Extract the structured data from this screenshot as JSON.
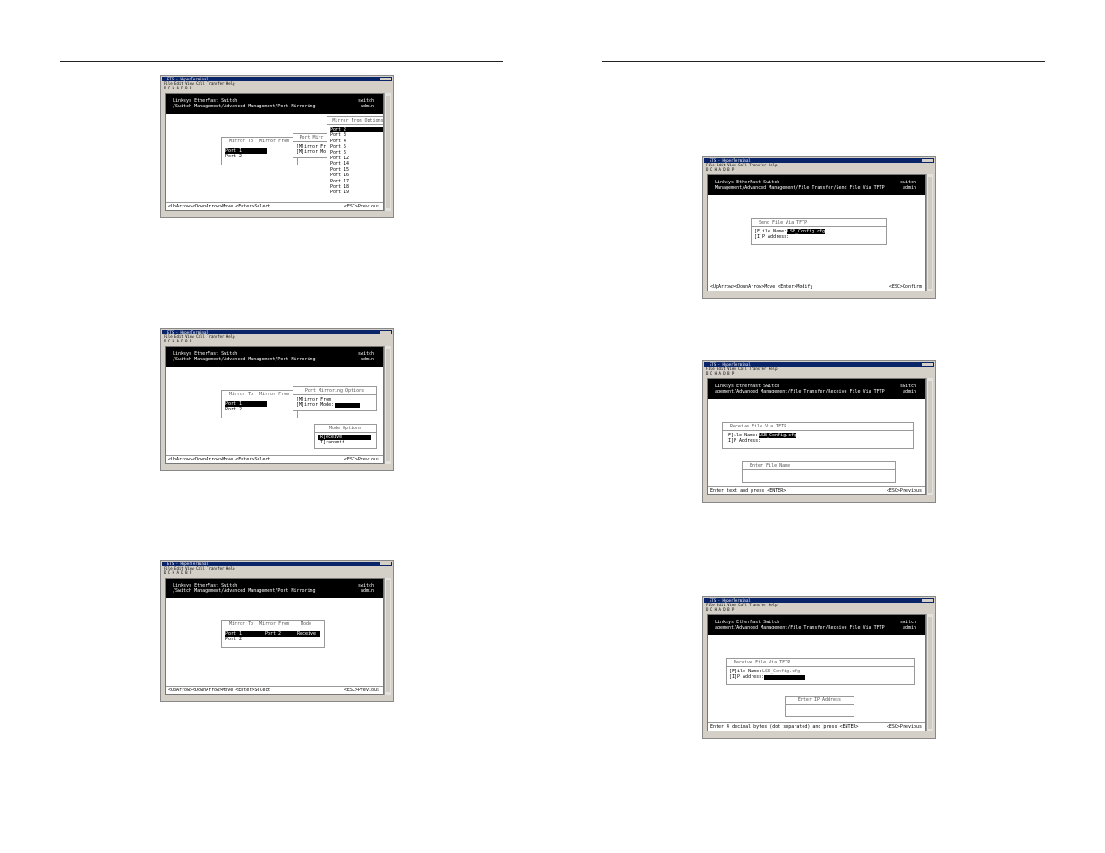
{
  "app": {
    "title": "ETS - HyperTerminal",
    "menu": "File Edit View Call Transfer Help",
    "toolbar": "D  C  H  A  D  B  P"
  },
  "common": {
    "brand": "Linksys EtherFast Switch",
    "hostname": "switch",
    "user": "admin",
    "status_nav": "<UpArrow><DownArrow>Move <Enter>Select",
    "status_back": "<ESC>Previous"
  },
  "shot1": {
    "path": "/Switch Management/Advanced Management/Port Mirroring",
    "col_mirror_to": "Mirror To",
    "col_mirror_from": "Mirror From",
    "rows": [
      "Port 1",
      "Port 2"
    ],
    "options_title": "Port Mirr",
    "option_from": "[M]irror Fr",
    "option_mode": "[M]irror Mo",
    "list_title": "Mirror From Options",
    "ports": [
      "Port 2",
      "Port 3",
      "Port 4",
      "Port 5",
      "Port 6",
      "Port 12",
      "Port 14",
      "Port 15",
      "Port 16",
      "Port 17",
      "Port 18",
      "Port 19"
    ]
  },
  "shot2": {
    "path": "/Switch Management/Advanced Management/Port Mirroring",
    "col_mirror_to": "Mirror To",
    "col_mirror_from": "Mirror From",
    "rows": [
      "Port 1",
      "Port 2"
    ],
    "options_title": "Port Mirroring Options",
    "option_from": "[M]irror From",
    "option_mode": "[M]irror Mode:",
    "mode_title": "Mode Options",
    "modes": [
      "[R]eceive",
      "[T]ransmit"
    ]
  },
  "shot3": {
    "path": "/Switch Management/Advanced Management/Port Mirroring",
    "col_mirror_to": "Mirror To",
    "col_mirror_from": "Mirror From",
    "col_mode": "Mode",
    "row1": {
      "to": "Port 1",
      "from": "Port 2",
      "mode": "Receive"
    },
    "row2": "Port 2"
  },
  "shot4": {
    "path": "Management/Advanced Management/File Transfer/Send File Via TFTP",
    "box_title": "Send File Via TFTP",
    "file_label": "[F]ile Name:",
    "file_value": "LSB_Config.cfg",
    "ip_label": "[I]P Address:",
    "status_left": "<UpArrow><DownArrow>Move <Enter>Modify",
    "status_right": "<ESC>Confirm"
  },
  "shot5": {
    "path": "agement/Advanced Management/File Transfer/Receive File Via TFTP",
    "box_title": "Receive File Via TFTP",
    "file_label": "[F]ile Name:",
    "file_value": "LSB_Config.cfg",
    "ip_label": "[I]P Address:",
    "prompt_title": "Enter File Name",
    "status_left": "Enter text and press <ENTER>",
    "status_right": "<ESC>Previous"
  },
  "shot6": {
    "path": "agement/Advanced Management/File Transfer/Receive File Via TFTP",
    "box_title": "Receive File Via TFTP",
    "file_label": "[F]ile Name:",
    "file_value": "LSB_Config.cfg",
    "ip_label": "[I]P Address:",
    "prompt_title": "Enter IP Address",
    "status_left": "Enter 4 decimal bytes (dot separated) and press <ENTER>",
    "status_right": "<ESC>Previous"
  }
}
